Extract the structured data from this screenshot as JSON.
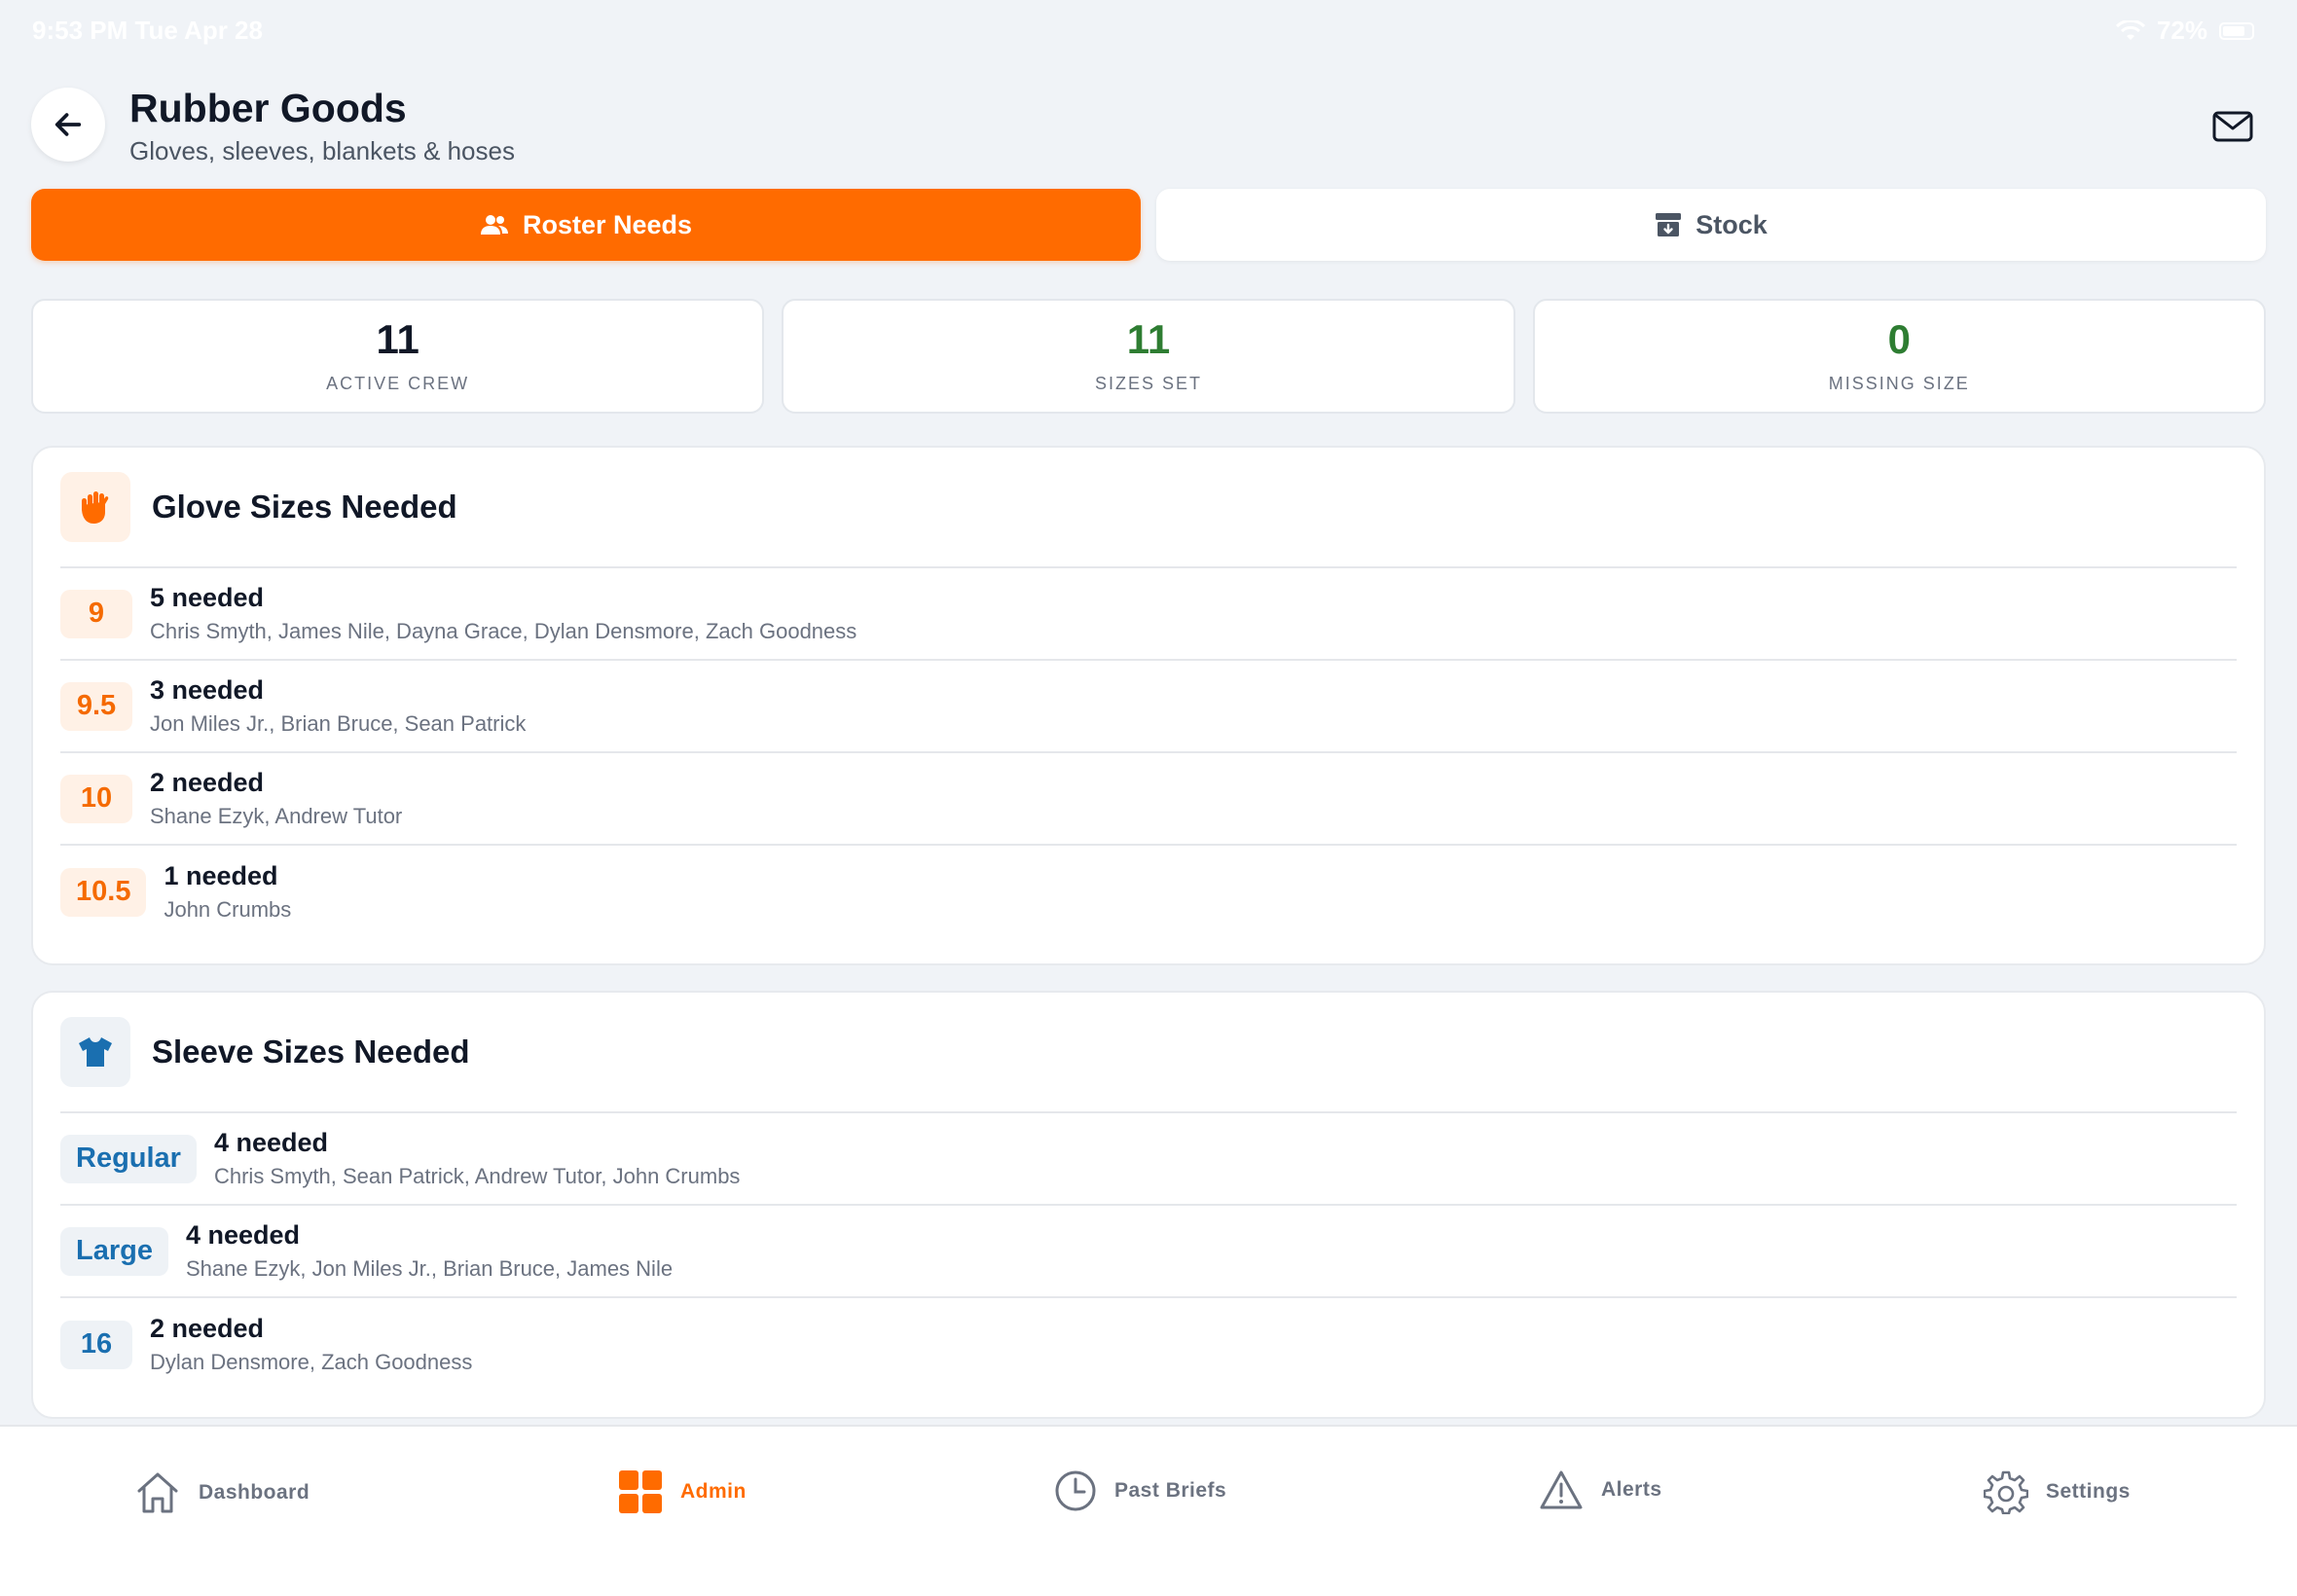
{
  "status_bar": {
    "time": "9:53 PM  Tue Apr 28",
    "battery": "72%"
  },
  "header": {
    "title": "Rubber Goods",
    "subtitle": "Gloves, sleeves, blankets & hoses"
  },
  "tabs": [
    {
      "label": "Roster Needs",
      "icon": "people-icon",
      "active": true
    },
    {
      "label": "Stock",
      "icon": "archive-box-icon",
      "active": false
    }
  ],
  "stats": [
    {
      "value": "11",
      "label": "ACTIVE CREW",
      "color": "#111827"
    },
    {
      "value": "11",
      "label": "SIZES SET",
      "color": "#2E7D32"
    },
    {
      "value": "0",
      "label": "MISSING SIZE",
      "color": "#2E7D32"
    }
  ],
  "gloves": {
    "title": "Glove Sizes Needed",
    "icon": "hand-icon",
    "rows": [
      {
        "size": "9",
        "count": "5 needed",
        "names": "Chris Smyth, James Nile, Dayna Grace, Dylan Densmore, Zach Goodness"
      },
      {
        "size": "9.5",
        "count": "3 needed",
        "names": "Jon Miles Jr., Brian Bruce, Sean Patrick"
      },
      {
        "size": "10",
        "count": "2 needed",
        "names": "Shane Ezyk, Andrew Tutor"
      },
      {
        "size": "10.5",
        "count": "1 needed",
        "names": "John Crumbs"
      }
    ]
  },
  "sleeves": {
    "title": "Sleeve Sizes Needed",
    "icon": "shirt-icon",
    "rows": [
      {
        "size": "Regular",
        "count": "4 needed",
        "names": "Chris Smyth, Sean Patrick, Andrew Tutor, John Crumbs"
      },
      {
        "size": "Large",
        "count": "4 needed",
        "names": "Shane Ezyk, Jon Miles Jr., Brian Bruce, James Nile"
      },
      {
        "size": "16",
        "count": "2 needed",
        "names": "Dylan Densmore, Zach Goodness"
      }
    ]
  },
  "nav": [
    {
      "label": "Dashboard",
      "icon": "home-icon",
      "active": false
    },
    {
      "label": "Admin",
      "icon": "grid-icon",
      "active": true
    },
    {
      "label": "Past Briefs",
      "icon": "clock-icon",
      "active": false
    },
    {
      "label": "Alerts",
      "icon": "warning-icon",
      "active": false
    },
    {
      "label": "Settings",
      "icon": "gear-icon",
      "active": false
    }
  ],
  "colors": {
    "accent": "#FF6B00",
    "success": "#2E7D32",
    "sleeve_blue": "#1A6FB0"
  }
}
